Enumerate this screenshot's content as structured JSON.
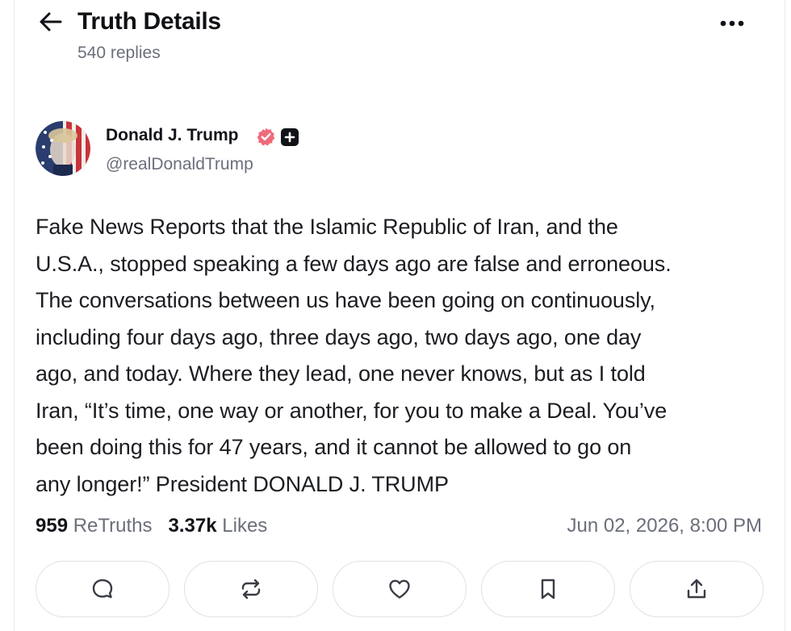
{
  "header": {
    "title": "Truth Details",
    "replies": "540 replies",
    "back_icon": "arrow-left-icon",
    "more_icon": "more-horizontal-icon"
  },
  "author": {
    "name": "Donald J. Trump",
    "handle": "@realDonaldTrump",
    "verified_icon": "verified-badge-icon",
    "verified_color": "#ef6a7a",
    "plus_icon": "plus-badge-icon"
  },
  "post": {
    "text": "Fake News Reports that the Islamic Republic of Iran, and the\nU.S.A., stopped speaking a few days ago are false and erroneous.\nThe conversations between us have been going on continuously,\nincluding four days ago, three days ago, two days ago, one day\nago, and today. Where they lead, one never knows, but as I told\nIran, “It’s time, one way or another, for you to make a Deal. You’ve\nbeen doing this for 47 years, and it cannot be allowed to go on\nany longer!” President DONALD J. TRUMP"
  },
  "stats": {
    "retruths_count": "959",
    "retruths_label": "ReTruths",
    "likes_count": "3.37k",
    "likes_label": "Likes",
    "timestamp": "Jun 02, 2026, 8:00 PM"
  },
  "actions": [
    {
      "name": "reply",
      "icon": "reply-icon"
    },
    {
      "name": "retruth",
      "icon": "retruth-icon"
    },
    {
      "name": "like",
      "icon": "heart-icon"
    },
    {
      "name": "bookmark",
      "icon": "bookmark-icon"
    },
    {
      "name": "share",
      "icon": "share-icon"
    }
  ],
  "colors": {
    "text_primary": "#111318",
    "text_secondary": "#6b6f7a",
    "border": "#dfe1e6"
  }
}
